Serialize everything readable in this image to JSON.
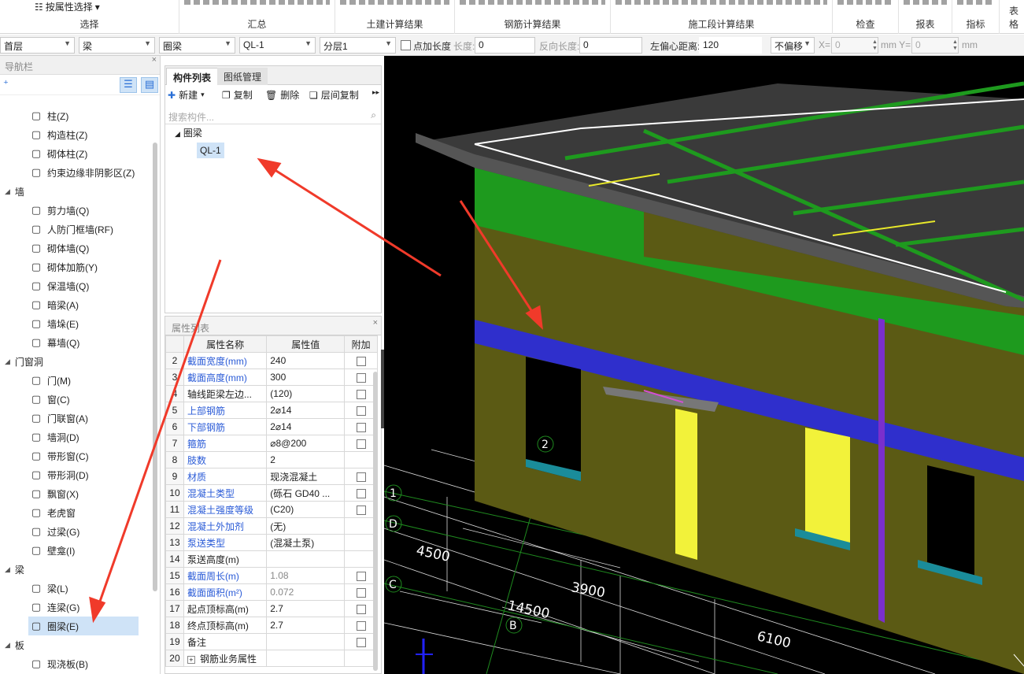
{
  "ribbon": {
    "attr_select": "按属性选择",
    "groups": [
      "选择",
      "汇总",
      "土建计算结果",
      "钢筋计算结果",
      "施工段计算结果",
      "检查",
      "报表",
      "指标",
      "表格"
    ]
  },
  "toolbar": {
    "floor": "首层",
    "type": "梁",
    "subtype": "圈梁",
    "component": "QL-1",
    "layer": "分层1",
    "point_length_label": "点加长度",
    "length_label": "长度:",
    "length_value": "0",
    "reverse_length_label": "反向长度:",
    "reverse_length_value": "0",
    "left_offset_label": "左偏心距离:",
    "left_offset_value": "120",
    "offset_mode": "不偏移",
    "x_label": "X=",
    "x_value": "0",
    "y_label": "mm Y=",
    "y_value": "0",
    "mm": "mm"
  },
  "nav": {
    "title": "导航栏",
    "items": [
      {
        "label": "柱(Z)",
        "icon": "column-icon",
        "kind": "item"
      },
      {
        "label": "构造柱(Z)",
        "icon": "constructional-column-icon",
        "kind": "item"
      },
      {
        "label": "砌体柱(Z)",
        "icon": "masonry-column-icon",
        "kind": "item"
      },
      {
        "label": "约束边缘非阴影区(Z)",
        "icon": "edge-zone-icon",
        "kind": "item"
      },
      {
        "label": "墙",
        "kind": "cat"
      },
      {
        "label": "剪力墙(Q)",
        "icon": "shear-wall-icon",
        "kind": "item"
      },
      {
        "label": "人防门框墙(RF)",
        "icon": "blast-door-wall-icon",
        "kind": "item"
      },
      {
        "label": "砌体墙(Q)",
        "icon": "masonry-wall-icon",
        "kind": "item"
      },
      {
        "label": "砌体加筋(Y)",
        "icon": "masonry-rebar-icon",
        "kind": "item"
      },
      {
        "label": "保温墙(Q)",
        "icon": "insulation-wall-icon",
        "kind": "item"
      },
      {
        "label": "暗梁(A)",
        "icon": "hidden-beam-icon",
        "kind": "item"
      },
      {
        "label": "墙垛(E)",
        "icon": "wall-pier-icon",
        "kind": "item"
      },
      {
        "label": "幕墙(Q)",
        "icon": "curtain-wall-icon",
        "kind": "item"
      },
      {
        "label": "门窗洞",
        "kind": "cat"
      },
      {
        "label": "门(M)",
        "icon": "door-icon",
        "kind": "item"
      },
      {
        "label": "窗(C)",
        "icon": "window-icon",
        "kind": "item"
      },
      {
        "label": "门联窗(A)",
        "icon": "door-window-icon",
        "kind": "item"
      },
      {
        "label": "墙洞(D)",
        "icon": "wall-hole-icon",
        "kind": "item"
      },
      {
        "label": "带形窗(C)",
        "icon": "strip-window-icon",
        "kind": "item"
      },
      {
        "label": "带形洞(D)",
        "icon": "strip-hole-icon",
        "kind": "item"
      },
      {
        "label": "飘窗(X)",
        "icon": "bay-window-icon",
        "kind": "item"
      },
      {
        "label": "老虎窗",
        "icon": "dormer-icon",
        "kind": "item"
      },
      {
        "label": "过梁(G)",
        "icon": "lintel-icon",
        "kind": "item"
      },
      {
        "label": "壁龛(I)",
        "icon": "niche-icon",
        "kind": "item"
      },
      {
        "label": "梁",
        "kind": "cat"
      },
      {
        "label": "梁(L)",
        "icon": "beam-icon",
        "kind": "item"
      },
      {
        "label": "连梁(G)",
        "icon": "coupling-beam-icon",
        "kind": "item"
      },
      {
        "label": "圈梁(E)",
        "icon": "ring-beam-icon",
        "kind": "item",
        "selected": true
      },
      {
        "label": "板",
        "kind": "cat"
      },
      {
        "label": "现浇板(B)",
        "icon": "cast-slab-icon",
        "kind": "item"
      }
    ]
  },
  "components": {
    "tab_active": "构件列表",
    "tab_inactive": "图纸管理",
    "new": "新建",
    "copy": "复制",
    "delete": "删除",
    "floor_copy": "层间复制",
    "search_placeholder": "搜索构件...",
    "tree_root": "圈梁",
    "tree_child": "QL-1"
  },
  "props": {
    "title": "属性列表",
    "headers": [
      "属性名称",
      "属性值",
      "附加"
    ],
    "rows": [
      {
        "n": "2",
        "name": "截面宽度(mm)",
        "value": "240",
        "blue": true,
        "check": true
      },
      {
        "n": "3",
        "name": "截面高度(mm)",
        "value": "300",
        "blue": true,
        "check": true
      },
      {
        "n": "4",
        "name": "轴线距梁左边...",
        "value": "(120)",
        "blue": false,
        "check": true
      },
      {
        "n": "5",
        "name": "上部钢筋",
        "value": "2⌀14",
        "blue": true,
        "check": true
      },
      {
        "n": "6",
        "name": "下部钢筋",
        "value": "2⌀14",
        "blue": true,
        "check": true
      },
      {
        "n": "7",
        "name": "箍筋",
        "value": "⌀8@200",
        "blue": true,
        "check": true
      },
      {
        "n": "8",
        "name": "肢数",
        "value": "2",
        "blue": true,
        "check": false
      },
      {
        "n": "9",
        "name": "材质",
        "value": "现浇混凝土",
        "blue": true,
        "check": true
      },
      {
        "n": "10",
        "name": "混凝土类型",
        "value": "(砾石 GD40 ...",
        "blue": true,
        "check": true
      },
      {
        "n": "11",
        "name": "混凝土强度等级",
        "value": "(C20)",
        "blue": true,
        "check": true
      },
      {
        "n": "12",
        "name": "混凝土外加剂",
        "value": "(无)",
        "blue": true,
        "check": false
      },
      {
        "n": "13",
        "name": "泵送类型",
        "value": "(混凝土泵)",
        "blue": true,
        "check": false
      },
      {
        "n": "14",
        "name": "泵送高度(m)",
        "value": "",
        "blue": false,
        "check": false
      },
      {
        "n": "15",
        "name": "截面周长(m)",
        "value": "1.08",
        "blue": true,
        "check": true,
        "grey": true
      },
      {
        "n": "16",
        "name": "截面面积(m²)",
        "value": "0.072",
        "blue": true,
        "check": true,
        "grey": true
      },
      {
        "n": "17",
        "name": "起点顶标高(m)",
        "value": "2.7",
        "blue": false,
        "check": true
      },
      {
        "n": "18",
        "name": "终点顶标高(m)",
        "value": "2.7",
        "blue": false,
        "check": true
      },
      {
        "n": "19",
        "name": "备注",
        "value": "",
        "blue": false,
        "check": true
      },
      {
        "n": "20",
        "name": "钢筋业务属性",
        "value": "",
        "blue": false,
        "check": false,
        "expand": true
      }
    ]
  },
  "viewport": {
    "dims": [
      "4500",
      "3900",
      "14500",
      "6100"
    ],
    "axes": [
      "1",
      "2",
      "D",
      "C",
      "B"
    ],
    "colors": {
      "wall": "#5b5a14",
      "ring_beam": "#2f2fcc",
      "top_beam": "#1e9a1e",
      "window": "#f2f23a",
      "column": "#7a2fcc"
    }
  }
}
